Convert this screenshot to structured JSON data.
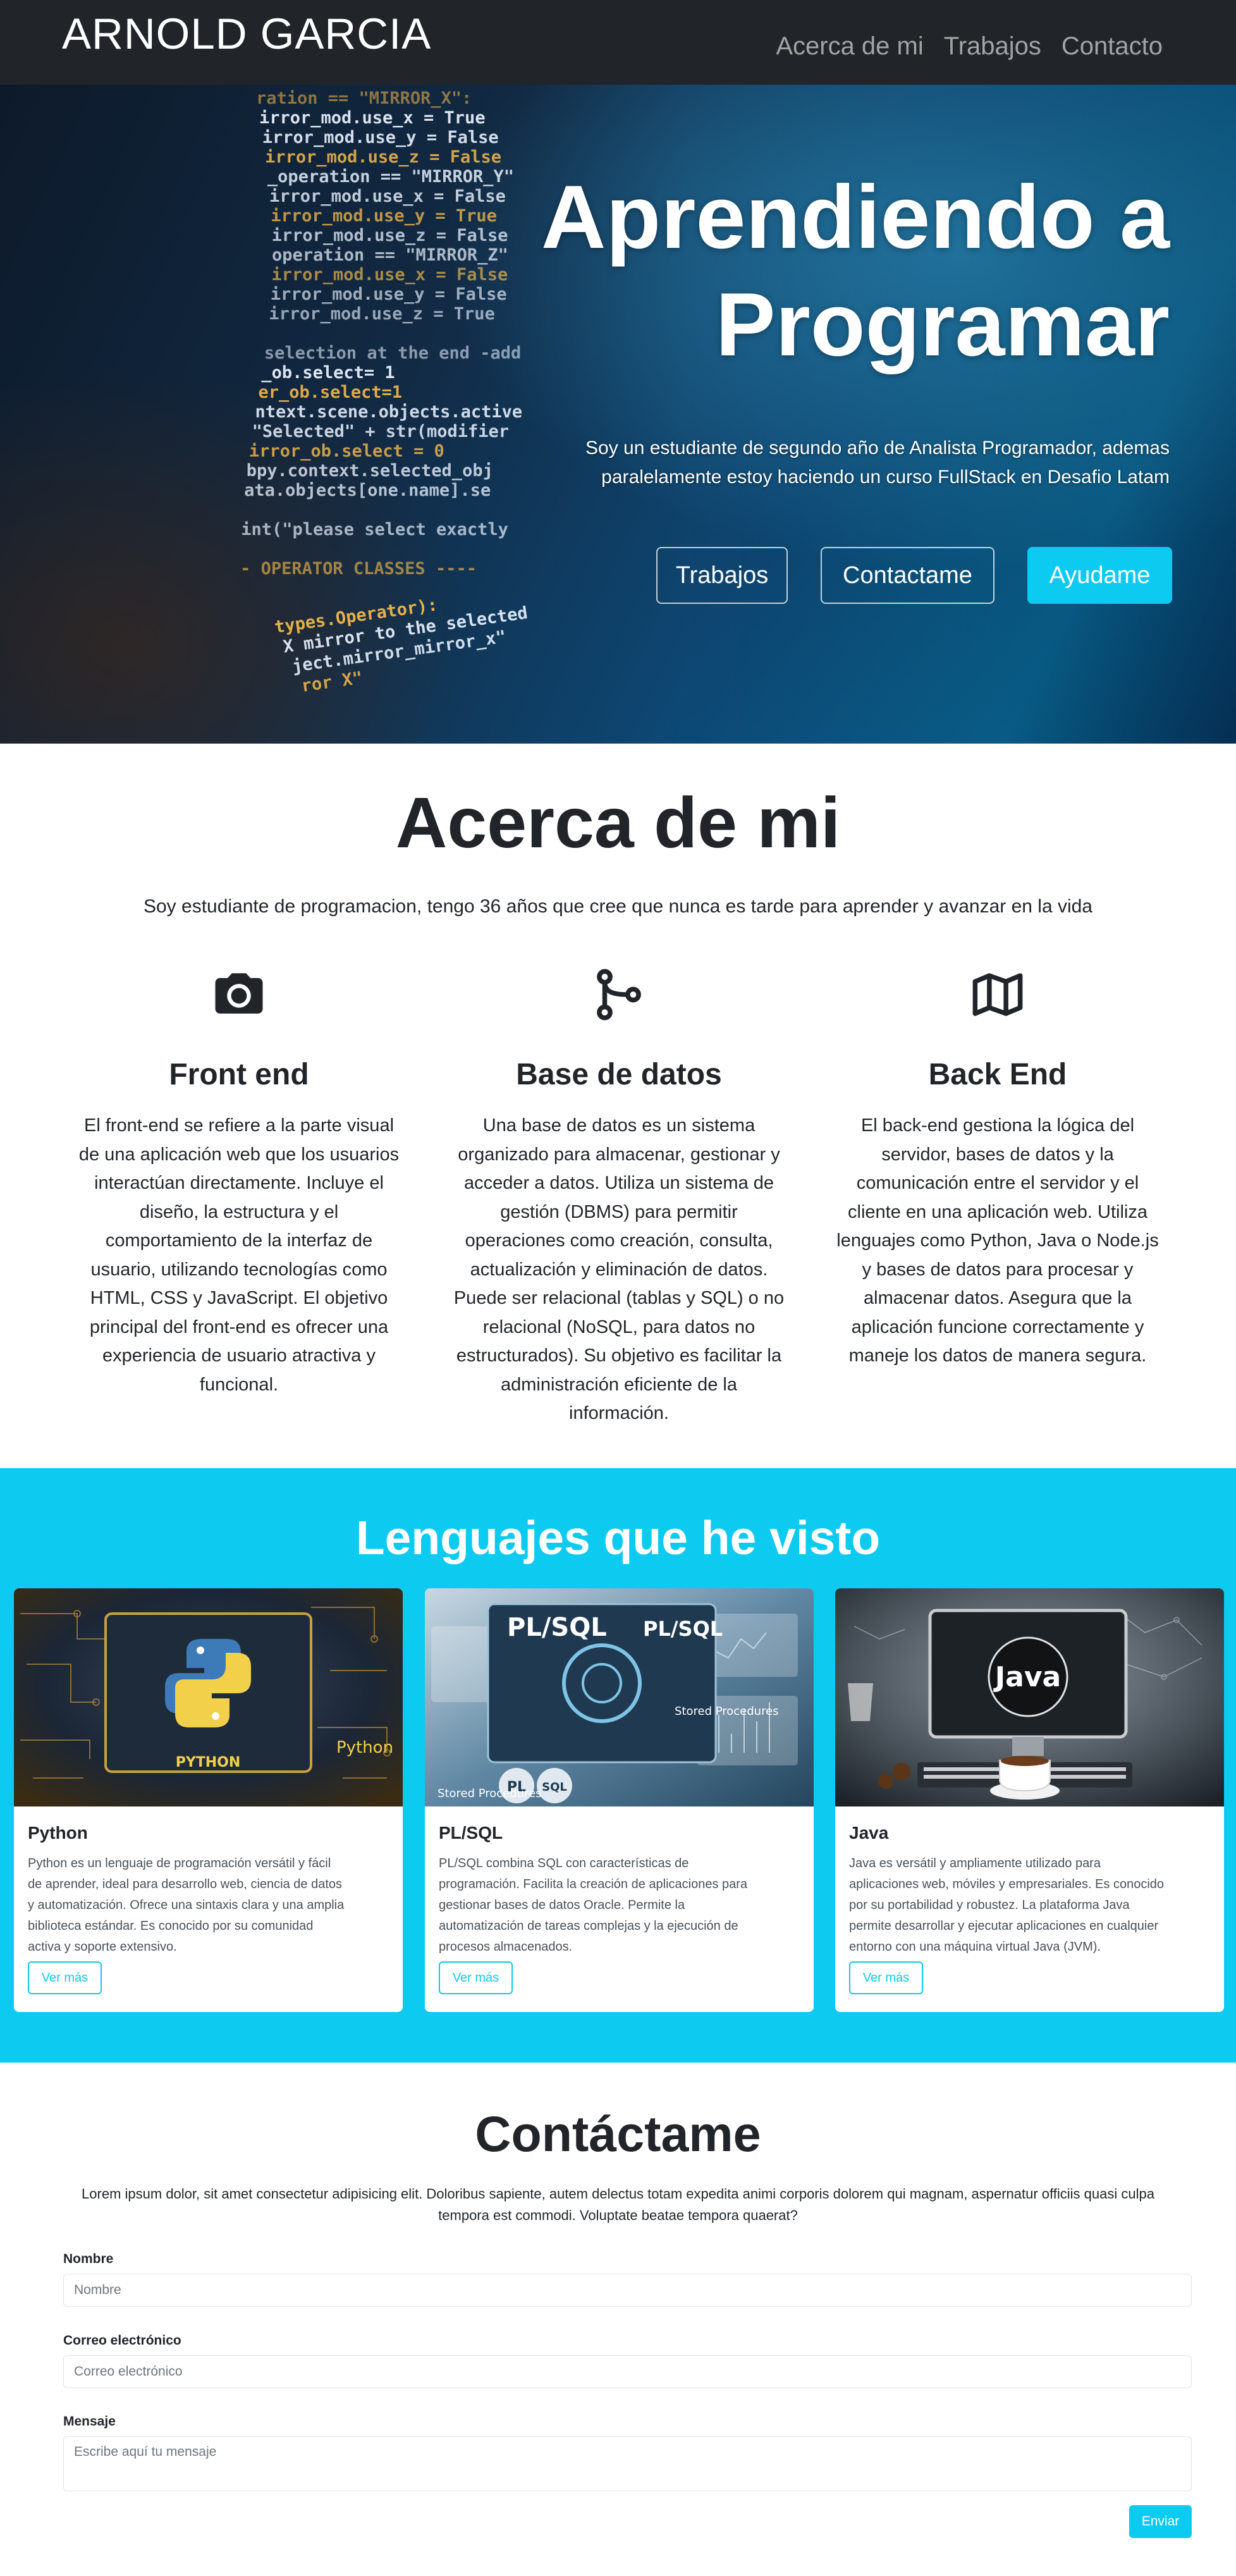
{
  "navbar": {
    "brand": "ARNOLD GARCIA",
    "links": [
      "Acerca de mi",
      "Trabajos",
      "Contacto"
    ]
  },
  "hero": {
    "title_line1": "Aprendiendo a",
    "title_line2": "Programar",
    "text_line1": "Soy un estudiante de segundo año de Analista Programador, ademas",
    "text_line2": "paralelamente estoy haciendo un curso FullStack en Desafio Latam",
    "buttons": [
      "Trabajos",
      "Contactame",
      "Ayudame"
    ],
    "code_lines": [
      "ration == \"MIRROR_X\":",
      "irror_mod.use_x = True",
      "irror_mod.use_y = False",
      "irror_mod.use_z = False",
      "_operation == \"MIRROR_Y\"",
      "irror_mod.use_x = False",
      "irror_mod.use_y = True",
      "irror_mod.use_z = False",
      "operation == \"MIRROR_Z\"",
      "irror_mod.use_x = False",
      "irror_mod.use_y = False",
      "irror_mod.use_z = True",
      "",
      "selection at the end -add",
      "_ob.select= 1",
      "er_ob.select=1",
      "ntext.scene.objects.active",
      "\"Selected\" + str(modifier",
      "irror_ob.select = 0",
      "bpy.context.selected_obj",
      "ata.objects[one.name].se",
      "",
      "int(\"please select exactly",
      "",
      "- OPERATOR CLASSES ----",
      "",
      "",
      "types.Operator):",
      "X mirror to the selected",
      "ject.mirror_mirror_x\"",
      "ror X\""
    ]
  },
  "about": {
    "title": "Acerca de mi",
    "intro": "Soy estudiante de programacion, tengo 36 años que cree que nunca es tarde para aprender y avanzar en la vida",
    "features": [
      {
        "icon": "camera-icon",
        "title": "Front end",
        "lines": [
          "El front-end se refiere a la parte visual",
          "de una aplicación web que los usuarios",
          "interactúan directamente. Incluye el",
          "diseño, la estructura y el",
          "comportamiento de la interfaz de",
          "usuario, utilizando tecnologías como",
          "HTML, CSS y JavaScript. El objetivo",
          "principal del front-end es ofrecer una",
          "experiencia de usuario atractiva y",
          "funcional."
        ]
      },
      {
        "icon": "branch-icon",
        "title": "Base de datos",
        "lines": [
          "Una base de datos es un sistema",
          "organizado para almacenar, gestionar y",
          "acceder a datos. Utiliza un sistema de",
          "gestión (DBMS) para permitir",
          "operaciones como creación, consulta,",
          "actualización y eliminación de datos.",
          "Puede ser relacional (tablas y SQL) o no",
          "relacional (NoSQL, para datos no",
          "estructurados). Su objetivo es facilitar la",
          "administración eficiente de la",
          "información."
        ]
      },
      {
        "icon": "map-icon",
        "title": "Back End",
        "lines": [
          "El back-end gestiona la lógica del",
          "servidor, bases de datos y la",
          "comunicación entre el servidor y el",
          "cliente en una aplicación web. Utiliza",
          "lenguajes como Python, Java o Node.js",
          "y bases de datos para procesar y",
          "almacenar datos. Asegura que la",
          "aplicación funcione correctamente y",
          "maneje los datos de manera segura."
        ]
      }
    ]
  },
  "languages": {
    "title": "Lenguajes que he visto",
    "button_label": "Ver más",
    "cards": [
      {
        "title": "Python",
        "image_label": "PYTHON",
        "lines": [
          "Python es un lenguaje de programación versátil y fácil",
          "de aprender, ideal para desarrollo web, ciencia de datos",
          "y automatización. Ofrece una sintaxis clara y una amplia",
          "biblioteca estándar. Es conocido por su comunidad",
          "activa y soporte extensivo."
        ]
      },
      {
        "title": "PL/SQL",
        "image_label": "PL/SQL",
        "image_sub": "Stored Procedures",
        "lines": [
          "PL/SQL combina SQL con características de",
          "programación. Facilita la creación de aplicaciones para",
          "gestionar bases de datos Oracle. Permite la",
          "automatización de tareas complejas y la ejecución de",
          "procesos almacenados."
        ]
      },
      {
        "title": "Java",
        "image_label": "Java",
        "lines": [
          "Java es versátil y ampliamente utilizado para",
          "aplicaciones web, móviles y empresariales. Es conocido",
          "por su portabilidad y robustez. La plataforma Java",
          "permite desarrollar y ejecutar aplicaciones en cualquier",
          "entorno con una máquina virtual Java (JVM)."
        ]
      }
    ]
  },
  "contact": {
    "title": "Contáctame",
    "intro_line1": "Lorem ipsum dolor, sit amet consectetur adipisicing elit. Doloribus sapiente, autem delectus totam expedita animi corporis dolorem qui magnam, aspernatur officiis quasi culpa",
    "intro_line2": "tempora est commodi. Voluptate beatae tempora quaerat?",
    "name_label": "Nombre",
    "name_placeholder": "Nombre",
    "email_label": "Correo electrónico",
    "email_placeholder": "Correo electrónico",
    "message_label": "Mensaje",
    "message_placeholder": "Escribe aquí tu mensaje",
    "submit": "Enviar"
  },
  "colors": {
    "navbar_bg": "#212529",
    "accent": "#0dcaf0",
    "text": "#212529"
  }
}
